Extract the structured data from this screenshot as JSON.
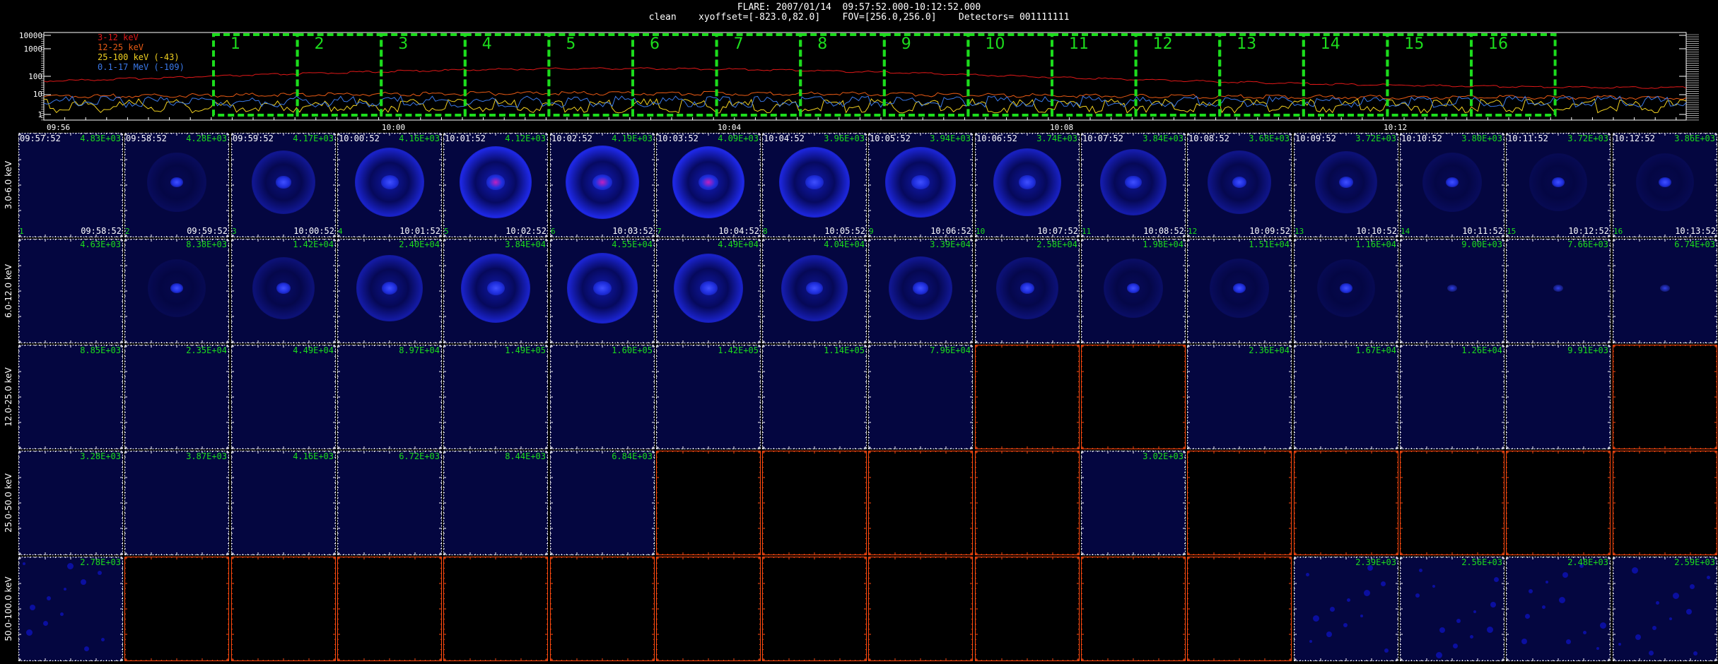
{
  "header": {
    "line1": "FLARE: 2007/01/14  09:57:52.000-10:12:52.000",
    "line2": "clean    xyoffset=[-823.0,82.0]    FOV=[256.0,256.0]    Detectors= 001111111"
  },
  "lightcurve": {
    "legend": [
      {
        "label": "3-12 keV",
        "color": "#e01818"
      },
      {
        "label": "12-25 keV",
        "color": "#e85a14"
      },
      {
        "label": "25-100 keV (-43)",
        "color": "#f0d020"
      },
      {
        "label": "0.1-17 MeV (-109)",
        "color": "#3a78e8"
      }
    ],
    "y_ticks": [
      "10000",
      "1000",
      "100",
      "10",
      "1"
    ],
    "x_ticks": [
      "09:56",
      "10:00",
      "10:04",
      "10:08",
      "10:12"
    ],
    "interval_labels": [
      "1",
      "2",
      "3",
      "4",
      "5",
      "6",
      "7",
      "8",
      "9",
      "10",
      "11",
      "12",
      "13",
      "14",
      "15",
      "16"
    ],
    "interval_color": "#1cdc1c"
  },
  "energy_bands": [
    "3.0-6.0 keV",
    "6.0-12.0 keV",
    "12.0-25.0 keV",
    "25.0-50.0 keV",
    "50.0-100.0 keV"
  ],
  "start_times": [
    "09:57:52",
    "09:58:52",
    "09:59:52",
    "10:00:52",
    "10:01:52",
    "10:02:52",
    "10:03:52",
    "10:04:52",
    "10:05:52",
    "10:06:52",
    "10:07:52",
    "10:08:52",
    "10:09:52",
    "10:10:52",
    "10:11:52",
    "10:12:52"
  ],
  "end_times": [
    "09:58:52",
    "09:59:52",
    "10:00:52",
    "10:01:52",
    "10:02:52",
    "10:03:52",
    "10:04:52",
    "10:05:52",
    "10:06:52",
    "10:07:52",
    "10:08:52",
    "10:09:52",
    "10:10:52",
    "10:11:52",
    "10:12:52",
    "10:13:52"
  ],
  "image_max": [
    [
      "4.83E+03",
      "4.28E+03",
      "4.17E+03",
      "4.16E+03",
      "4.12E+03",
      "4.19E+03",
      "4.09E+03",
      "3.96E+03",
      "3.94E+03",
      "3.74E+03",
      "3.84E+03",
      "3.68E+03",
      "3.72E+03",
      "3.80E+03",
      "3.72E+03",
      "3.86E+03"
    ],
    [
      "4.63E+03",
      "8.38E+03",
      "1.42E+04",
      "2.40E+04",
      "3.84E+04",
      "4.55E+04",
      "4.49E+04",
      "4.04E+04",
      "3.39E+04",
      "2.58E+04",
      "1.98E+04",
      "1.51E+04",
      "1.16E+04",
      "9.00E+03",
      "7.66E+03",
      "6.74E+03"
    ],
    [
      "8.85E+03",
      "2.35E+04",
      "4.49E+04",
      "8.97E+04",
      "1.49E+05",
      "1.60E+05",
      "1.42E+05",
      "1.14E+05",
      "7.96E+04",
      "",
      "",
      "2.36E+04",
      "1.67E+04",
      "1.26E+04",
      "9.91E+03",
      ""
    ],
    [
      "3.28E+03",
      "3.87E+03",
      "4.16E+03",
      "6.72E+03",
      "8.44E+03",
      "6.84E+03",
      "",
      "",
      "",
      "",
      "3.02E+03",
      "",
      "",
      "",
      "",
      ""
    ],
    [
      "2.78E+03",
      "",
      "",
      "",
      "",
      "",
      "",
      "",
      "",
      "",
      "",
      "",
      "2.39E+03",
      "2.56E+03",
      "2.48E+03",
      "2.59E+03"
    ]
  ],
  "image_strength": [
    [
      0.0,
      0.15,
      0.45,
      0.75,
      0.9,
      1.0,
      0.95,
      0.85,
      0.8,
      0.7,
      0.6,
      0.4,
      0.3,
      0.15,
      0.1,
      0.1
    ],
    [
      0.0,
      0.1,
      0.3,
      0.55,
      0.75,
      0.8,
      0.75,
      0.6,
      0.45,
      0.3,
      0.2,
      0.15,
      0.1,
      0.0,
      0.0,
      0.0
    ],
    [
      0,
      0,
      0,
      0,
      0,
      0,
      0,
      0,
      0,
      0,
      0,
      0,
      0,
      0,
      0,
      0
    ],
    [
      0,
      0,
      0,
      0,
      0,
      0,
      0,
      0,
      0,
      0,
      0,
      0,
      0,
      0,
      0,
      0
    ],
    [
      0.3,
      0,
      0,
      0,
      0,
      0,
      0,
      0,
      0,
      0,
      0,
      0,
      0.3,
      0.3,
      0.3,
      0.3
    ]
  ],
  "colors": {
    "image_bg": "#040640",
    "frame_white": "#ffffff",
    "frame_orange": "#ff4a10",
    "max_label": "#1cdc1c",
    "interval_box": "#1cdc1c"
  }
}
